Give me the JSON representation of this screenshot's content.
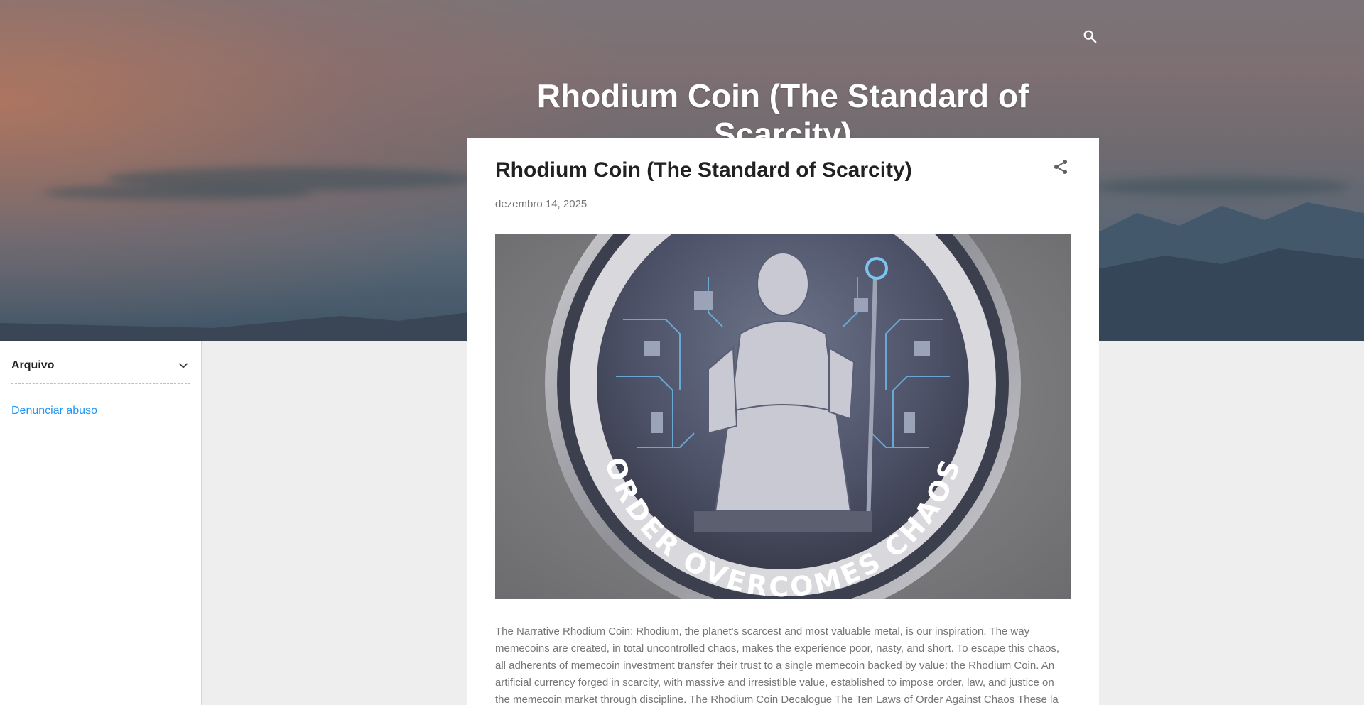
{
  "header": {
    "blog_title": "Rhodium Coin (The Standard of Scarcity)",
    "search_icon": "search-icon"
  },
  "sidebar": {
    "archive_label": "Arquivo",
    "archive_icon": "chevron-down-icon",
    "report_abuse_link": "Denunciar abuso"
  },
  "post": {
    "title": "Rhodium Coin (The Standard of Scarcity)",
    "share_icon": "share-icon",
    "date": "dezembro 14, 2025",
    "image": {
      "coin_text": "ORDER OVERCOMES CHAOS"
    },
    "snippet": "The Narrative Rhodium Coin: Rhodium, the planet's scarcest and most valuable metal, is our inspiration. The way memecoins are created, in total uncontrolled chaos, makes the experience poor, nasty, and short. To escape this chaos, all adherents of memecoin investment transfer their trust to a single memecoin backed by value: the Rhodium Coin. An artificial currency forged in scarcity, with massive and irresistible value, established to impose order, law, and justice on the memecoin market through discipline. The Rhodium Coin Decalogue The Ten Laws of Order Against Chaos These la",
    "ellipsis": "…"
  },
  "colors": {
    "link": "#2196f3",
    "title_text": "#212121",
    "meta_text": "#757575",
    "page_background": "#eeeeee"
  }
}
